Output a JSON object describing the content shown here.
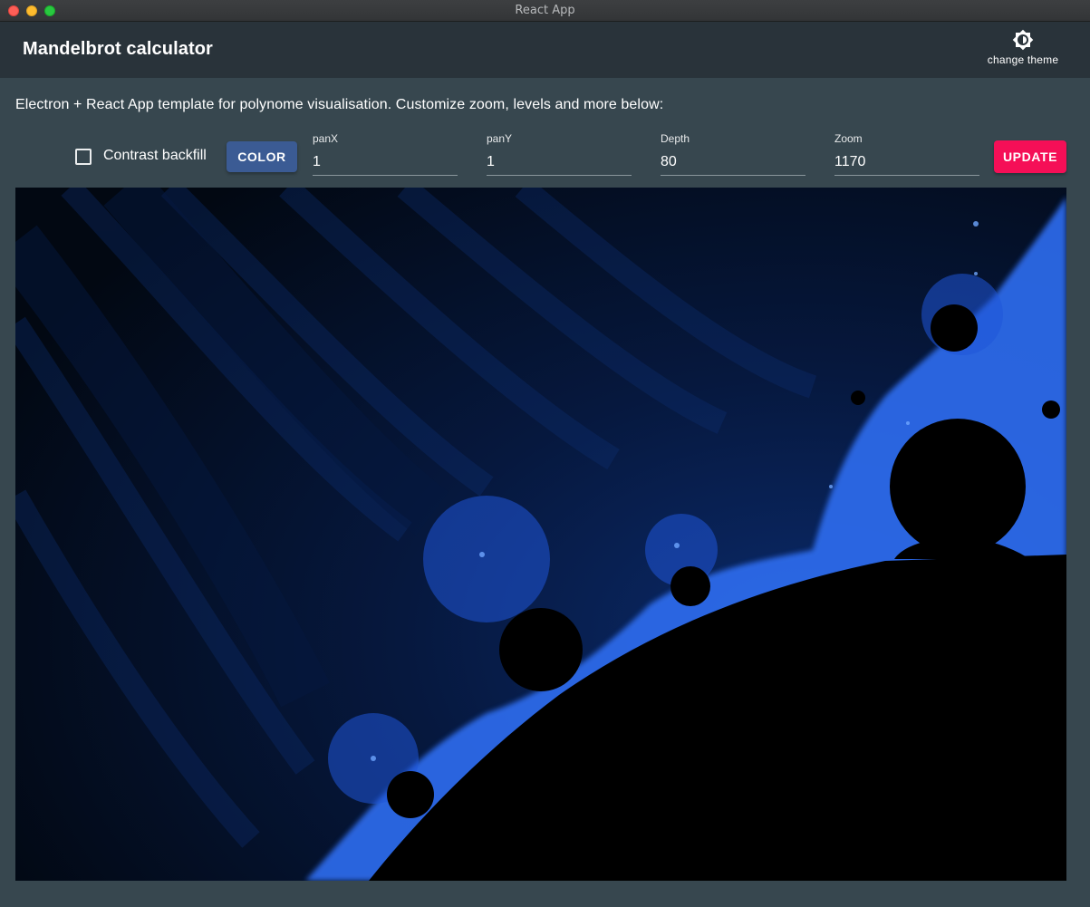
{
  "window": {
    "title": "React App"
  },
  "appbar": {
    "title": "Mandelbrot calculator",
    "theme_button_label": "change theme"
  },
  "controls": {
    "description": "Electron + React App template for polynome visualisation. Customize zoom, levels and more below:",
    "contrast_label": "Contrast backfill",
    "contrast_checked": false,
    "color_button": "COLOR",
    "panx": {
      "label": "panX",
      "value": "1"
    },
    "pany": {
      "label": "panY",
      "value": "1"
    },
    "depth": {
      "label": "Depth",
      "value": "80"
    },
    "zoom": {
      "label": "Zoom",
      "value": "1170"
    },
    "update_button": "UPDATE"
  },
  "colors": {
    "accent_primary": "#3b5b94",
    "accent_secondary": "#f50f57",
    "fractal_glow": "#2f6df0",
    "fractal_set": "#000000",
    "background": "#37474f"
  }
}
